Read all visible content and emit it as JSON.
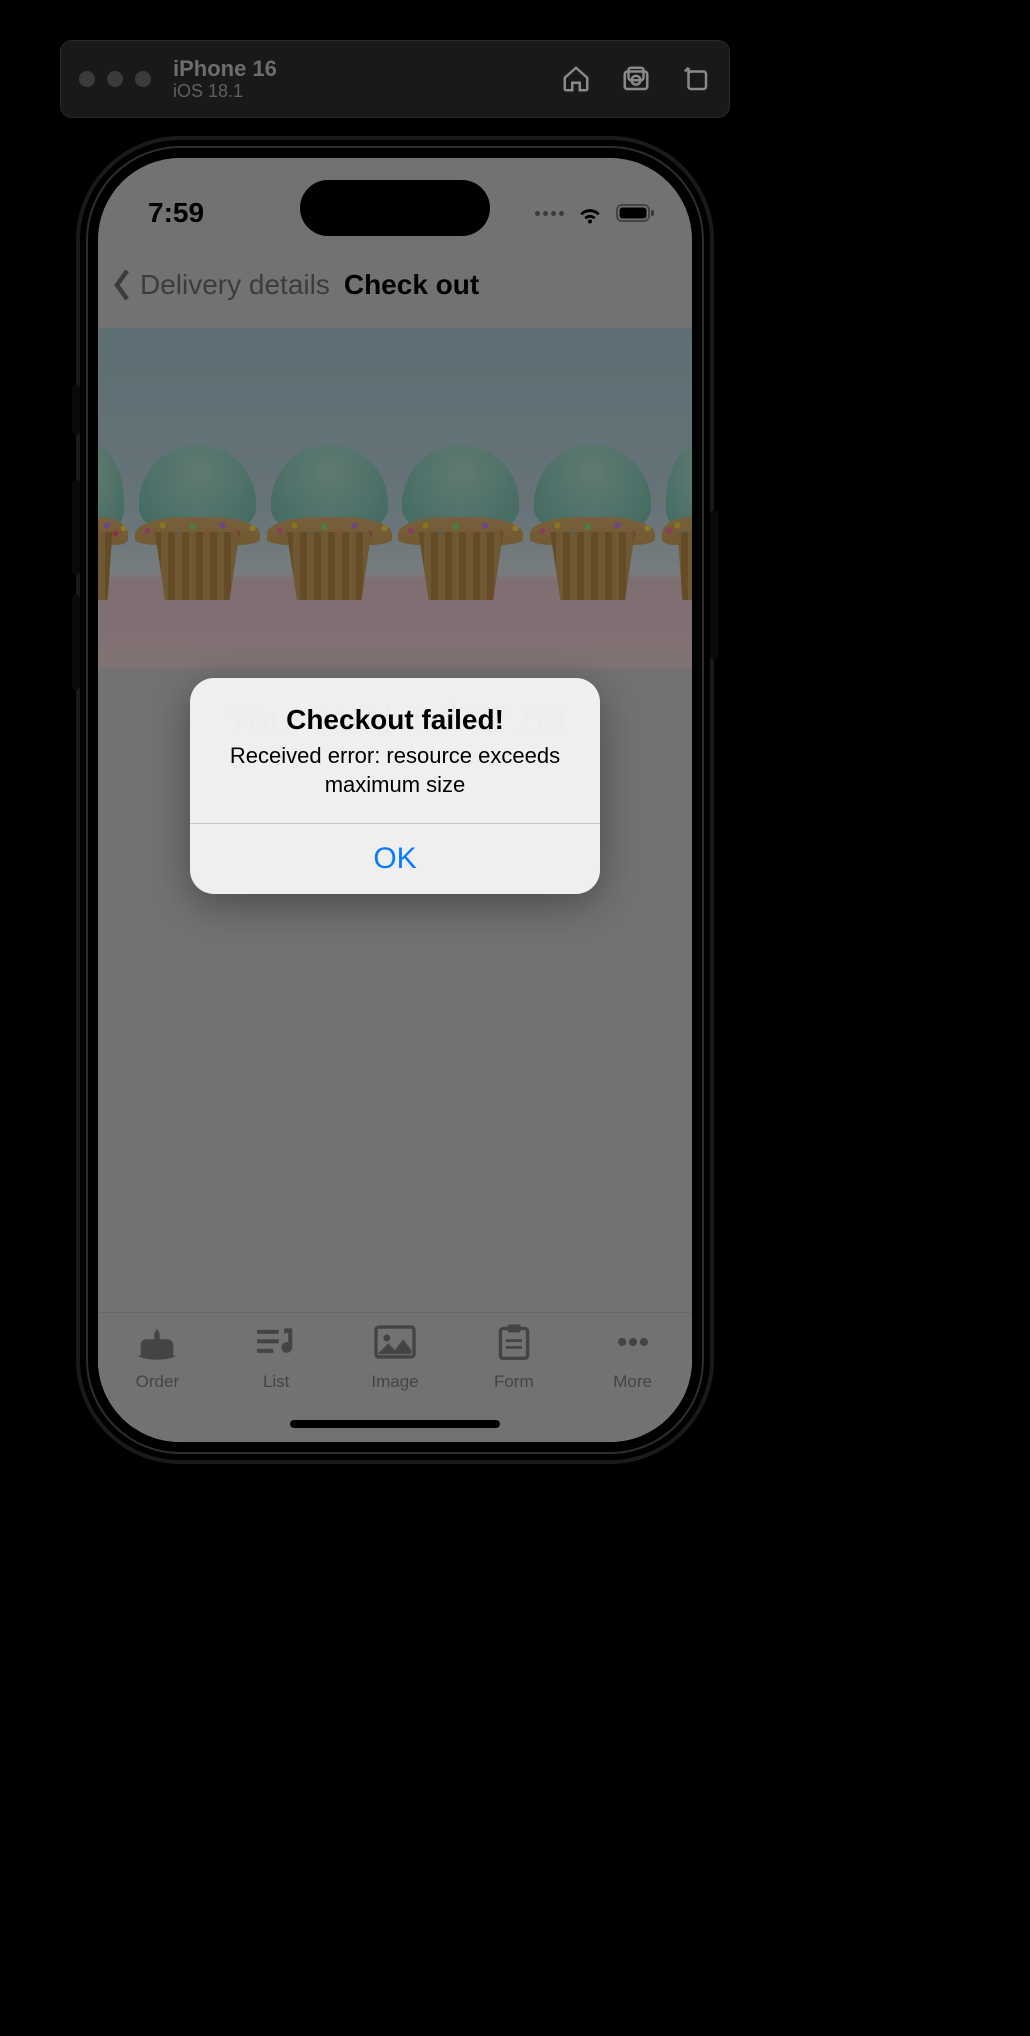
{
  "simulator": {
    "device": "iPhone 16",
    "os": "iOS 18.1"
  },
  "status_bar": {
    "time": "7:59"
  },
  "nav": {
    "back_label": "Delivery details",
    "title": "Check out"
  },
  "checkout": {
    "total_line": "Your total is $37.50"
  },
  "alert": {
    "title": "Checkout failed!",
    "message": "Received error: resource exceeds maximum size",
    "ok": "OK"
  },
  "tabs": {
    "order": "Order",
    "list": "List",
    "image": "Image",
    "form": "Form",
    "more": "More"
  }
}
